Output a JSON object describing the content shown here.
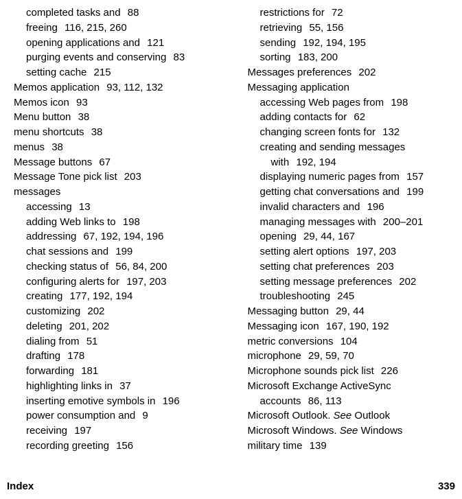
{
  "footer": {
    "left": "Index",
    "right": "339"
  },
  "left": [
    {
      "lvl": 1,
      "term": "completed tasks and",
      "pages": "88"
    },
    {
      "lvl": 1,
      "term": "freeing",
      "pages": "116, 215, 260"
    },
    {
      "lvl": 1,
      "term": "opening applications and",
      "pages": "121"
    },
    {
      "lvl": 1,
      "term": "purging events and conserving",
      "pages": "83"
    },
    {
      "lvl": 1,
      "term": "setting cache",
      "pages": "215"
    },
    {
      "lvl": 0,
      "term": "Memos application",
      "pages": "93, 112, 132"
    },
    {
      "lvl": 0,
      "term": "Memos icon",
      "pages": "93"
    },
    {
      "lvl": 0,
      "term": "Menu button",
      "pages": "38"
    },
    {
      "lvl": 0,
      "term": "menu shortcuts",
      "pages": "38"
    },
    {
      "lvl": 0,
      "term": "menus",
      "pages": "38"
    },
    {
      "lvl": 0,
      "term": "Message buttons",
      "pages": "67"
    },
    {
      "lvl": 0,
      "term": "Message Tone pick list",
      "pages": "203"
    },
    {
      "lvl": 0,
      "term": "messages",
      "pages": ""
    },
    {
      "lvl": 1,
      "term": "accessing",
      "pages": "13"
    },
    {
      "lvl": 1,
      "term": "adding Web links to",
      "pages": "198"
    },
    {
      "lvl": 1,
      "term": "addressing",
      "pages": "67, 192, 194, 196"
    },
    {
      "lvl": 1,
      "term": "chat sessions and",
      "pages": "199"
    },
    {
      "lvl": 1,
      "term": "checking status of",
      "pages": "56, 84, 200"
    },
    {
      "lvl": 1,
      "term": "configuring alerts for",
      "pages": "197, 203"
    },
    {
      "lvl": 1,
      "term": "creating",
      "pages": "177, 192, 194"
    },
    {
      "lvl": 1,
      "term": "customizing",
      "pages": "202"
    },
    {
      "lvl": 1,
      "term": "deleting",
      "pages": "201, 202"
    },
    {
      "lvl": 1,
      "term": "dialing from",
      "pages": "51"
    },
    {
      "lvl": 1,
      "term": "drafting",
      "pages": "178"
    },
    {
      "lvl": 1,
      "term": "forwarding",
      "pages": "181"
    },
    {
      "lvl": 1,
      "term": "highlighting links in",
      "pages": "37"
    },
    {
      "lvl": 1,
      "term": "inserting emotive symbols in",
      "pages": "196"
    },
    {
      "lvl": 1,
      "term": "power consumption and",
      "pages": "9"
    },
    {
      "lvl": 1,
      "term": "receiving",
      "pages": "197"
    },
    {
      "lvl": 1,
      "term": "recording greeting",
      "pages": "156"
    }
  ],
  "right": [
    {
      "lvl": 1,
      "term": "restrictions for",
      "pages": "72"
    },
    {
      "lvl": 1,
      "term": "retrieving",
      "pages": "55, 156"
    },
    {
      "lvl": 1,
      "term": "sending",
      "pages": "192, 194, 195"
    },
    {
      "lvl": 1,
      "term": "sorting",
      "pages": "183, 200"
    },
    {
      "lvl": 0,
      "term": "Messages preferences",
      "pages": "202"
    },
    {
      "lvl": 0,
      "term": "Messaging application",
      "pages": ""
    },
    {
      "lvl": 1,
      "term": "accessing Web pages from",
      "pages": "198"
    },
    {
      "lvl": 1,
      "term": "adding contacts for",
      "pages": "62"
    },
    {
      "lvl": 1,
      "term": "changing screen fonts for",
      "pages": "132"
    },
    {
      "lvl": 1,
      "term": "creating and sending messages",
      "pages": "",
      "cont": {
        "lvl": 2,
        "term": "with",
        "pages": "192, 194"
      }
    },
    {
      "lvl": 1,
      "term": "displaying numeric pages from",
      "pages": "157"
    },
    {
      "lvl": 1,
      "term": "getting chat conversations and",
      "pages": "199"
    },
    {
      "lvl": 1,
      "term": "invalid characters and",
      "pages": "196"
    },
    {
      "lvl": 1,
      "term": "managing messages with",
      "pages": "200–201"
    },
    {
      "lvl": 1,
      "term": "opening",
      "pages": "29, 44, 167"
    },
    {
      "lvl": 1,
      "term": "setting alert options",
      "pages": "197, 203"
    },
    {
      "lvl": 1,
      "term": "setting chat preferences",
      "pages": "203"
    },
    {
      "lvl": 1,
      "term": "setting message preferences",
      "pages": "202"
    },
    {
      "lvl": 1,
      "term": "troubleshooting",
      "pages": "245"
    },
    {
      "lvl": 0,
      "term": "Messaging button",
      "pages": "29, 44"
    },
    {
      "lvl": 0,
      "term": "Messaging icon",
      "pages": "167, 190, 192"
    },
    {
      "lvl": 0,
      "term": "metric conversions",
      "pages": "104"
    },
    {
      "lvl": 0,
      "term": "microphone",
      "pages": "29, 59, 70"
    },
    {
      "lvl": 0,
      "term": "Microphone sounds pick list",
      "pages": "226"
    },
    {
      "lvl": 0,
      "term": "Microsoft Exchange ActiveSync",
      "pages": "",
      "cont": {
        "lvl": 1,
        "term": "accounts",
        "pages": "86, 113"
      }
    },
    {
      "lvl": 0,
      "see": true,
      "term": "Microsoft Outlook.",
      "seeword": "See",
      "target": "Outlook"
    },
    {
      "lvl": 0,
      "see": true,
      "term": "Microsoft Windows.",
      "seeword": "See",
      "target": "Windows"
    },
    {
      "lvl": 0,
      "term": "military time",
      "pages": "139"
    }
  ]
}
